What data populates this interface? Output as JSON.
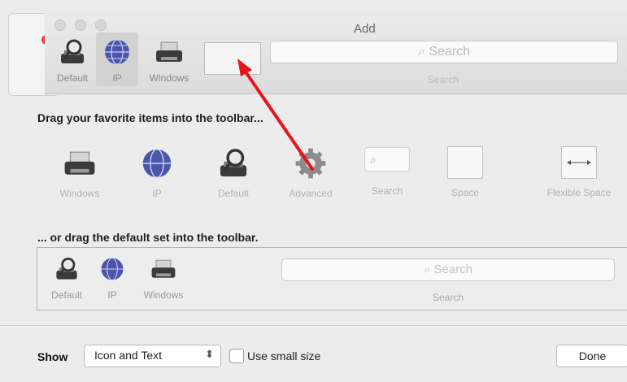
{
  "window": {
    "title": "Add"
  },
  "toolbar": {
    "items": [
      {
        "label": "Default",
        "icon": "printer-magnifier-icon"
      },
      {
        "label": "IP",
        "icon": "globe-icon",
        "selected": true
      },
      {
        "label": "Windows",
        "icon": "printer-icon"
      }
    ],
    "search": {
      "placeholder": "Search",
      "caption": "Search"
    }
  },
  "palette": {
    "heading": "Drag your favorite items into the toolbar...",
    "items": [
      {
        "label": "Windows",
        "icon": "printer-icon"
      },
      {
        "label": "IP",
        "icon": "globe-icon"
      },
      {
        "label": "Default",
        "icon": "printer-magnifier-icon"
      },
      {
        "label": "Advanced",
        "icon": "gear-icon"
      },
      {
        "label": "Search",
        "icon": "search-box-icon"
      },
      {
        "label": "Space",
        "icon": "space-box-icon"
      },
      {
        "label": "Flexible Space",
        "icon": "flexible-space-icon"
      }
    ]
  },
  "default_set": {
    "heading": "... or drag the default set into the toolbar.",
    "items": [
      {
        "label": "Default",
        "icon": "printer-magnifier-icon"
      },
      {
        "label": "IP",
        "icon": "globe-icon"
      },
      {
        "label": "Windows",
        "icon": "printer-icon"
      }
    ],
    "search": {
      "placeholder": "Search",
      "caption": "Search"
    }
  },
  "bottom": {
    "show_label": "Show",
    "show_value": "Icon and Text",
    "small_size_label": "Use small size",
    "done_label": "Done"
  },
  "colors": {
    "annotation_arrow": "#e8141b"
  }
}
